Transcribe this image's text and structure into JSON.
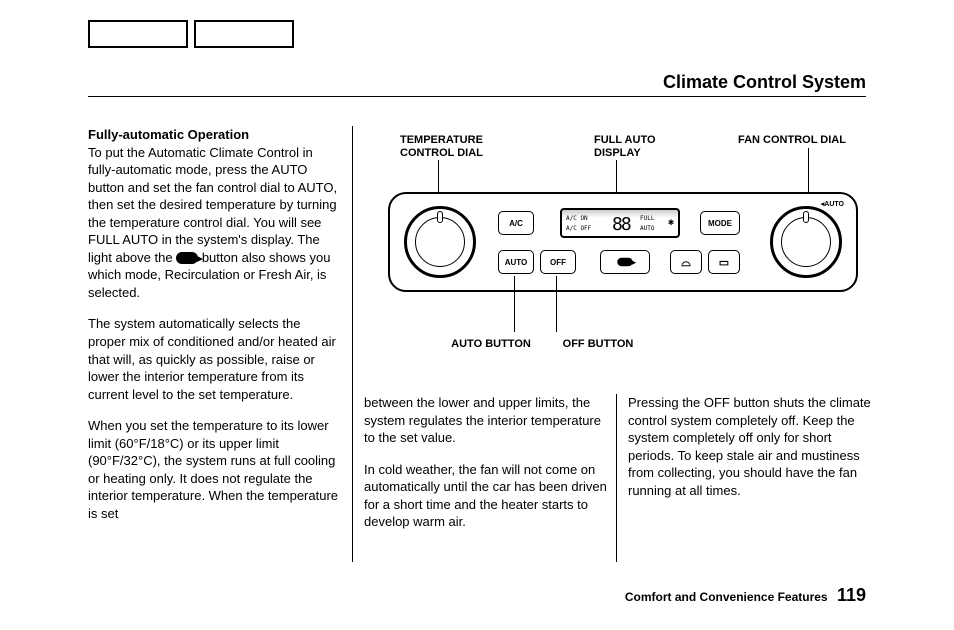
{
  "header": {
    "title": "Climate Control System"
  },
  "footer": {
    "section": "Comfort and Convenience Features",
    "page": "119"
  },
  "col1": {
    "heading": "Fully-automatic Operation",
    "p1a": "To put the Automatic Climate Control in fully-automatic mode, press the AUTO button and set the fan control dial to AUTO, then set the desired temperature by turning the temperature control dial. You will see FULL AUTO in the system's display. The light above the",
    "p1b": "button also shows you which mode, Recirculation or Fresh Air, is selected.",
    "p2": "The system automatically selects the proper mix of conditioned and/or heated air that will, as quickly as possible, raise or lower the interior temperature from its current level to the set temperature.",
    "p3": "When you set the temperature to its lower limit (60°F/18°C) or its upper limit (90°F/32°C), the system runs at full cooling or heating only. It does not regulate the interior temperature. When the temperature is set"
  },
  "col2": {
    "p1": "between the lower and upper limits, the system regulates the interior temperature to the set value.",
    "p2": "In cold weather, the fan will not come on automatically until the car has been driven for a short time and the heater starts to develop warm air."
  },
  "col3": {
    "p1": "Pressing the OFF button shuts the climate control system completely off. Keep the system completely off only for short periods. To keep stale air and mustiness from collecting, you should have the fan running at all times."
  },
  "diagram": {
    "labels": {
      "temp_dial": "TEMPERATURE CONTROL DIAL",
      "full_auto": "FULL AUTO DISPLAY",
      "fan_dial": "FAN CONTROL DIAL",
      "auto_btn": "AUTO BUTTON",
      "off_btn": "OFF BUTTON"
    },
    "panel": {
      "ac": "A/C",
      "mode": "MODE",
      "auto": "AUTO",
      "off": "OFF",
      "display_ac_on": "A/C ON",
      "display_ac_off": "A/C OFF",
      "display_full": "FULL",
      "display_auto": "AUTO",
      "display_88": "88",
      "dial_auto": "AUTO"
    }
  }
}
